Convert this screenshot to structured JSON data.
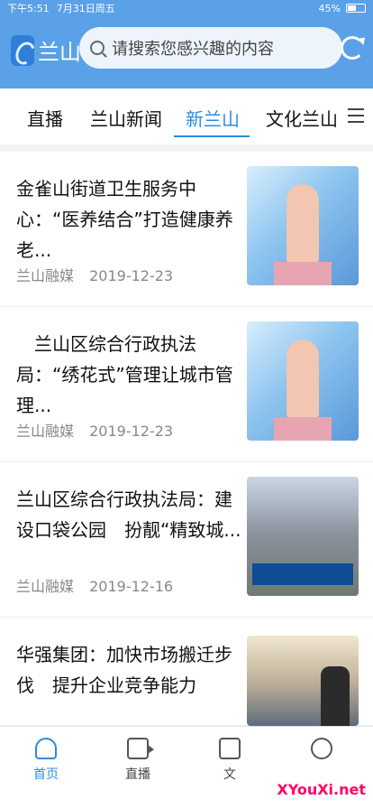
{
  "status_bar": {
    "time": "下午5:51",
    "date": "7月31日周五",
    "battery": "45%"
  },
  "header": {
    "app_name": "兰山",
    "search_placeholder": "请搜索您感兴趣的内容"
  },
  "tabs": [
    "直播",
    "兰山新闻",
    "新兰山",
    "文化兰山"
  ],
  "active_tab": "新兰山",
  "news": [
    {
      "title": "金雀山街道卫生服务中心：“医养结合”打造健康养老...",
      "source": "兰山融媒",
      "date": "2019-12-23",
      "thumb": "news"
    },
    {
      "title": "　兰山区综合行政执法局：“绣花式”管理让城市管理...",
      "source": "兰山融媒",
      "date": "2019-12-23",
      "thumb": "news"
    },
    {
      "title": "兰山区综合行政执法局：建设口袋公园　扮靓“精致城...",
      "source": "兰山融媒",
      "date": "2019-12-16",
      "thumb": "park"
    },
    {
      "title": "华强集团：加快市场搬迁步伐　提升企业竞争能力",
      "source": "",
      "date": "",
      "thumb": "street"
    }
  ],
  "bottom_nav": {
    "items": [
      "首页",
      "直播",
      "文",
      "XYouXi.net"
    ]
  }
}
